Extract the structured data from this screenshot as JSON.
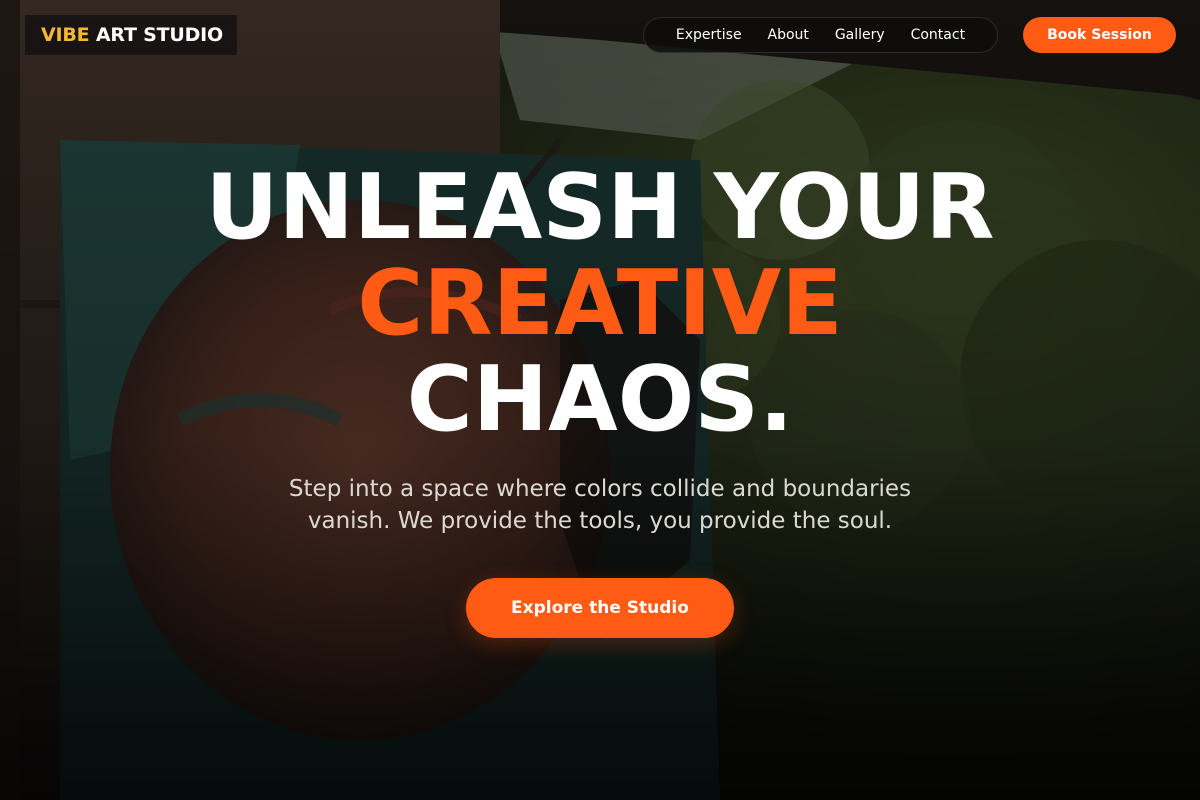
{
  "brand": {
    "accent_word": "VIBE",
    "rest": "ART STUDIO",
    "accent_color": "#f5b82e"
  },
  "nav": {
    "items": [
      {
        "label": "Expertise"
      },
      {
        "label": "About"
      },
      {
        "label": "Gallery"
      },
      {
        "label": "Contact"
      }
    ],
    "cta_label": "Book Session"
  },
  "hero": {
    "headline_line1": "UNLEASH YOUR",
    "headline_line2": "CREATIVE",
    "headline_line3": "CHAOS.",
    "subtitle": "Step into a space where colors collide and boundaries vanish. We provide the tools, you provide the soul.",
    "cta_label": "Explore the Studio"
  },
  "colors": {
    "primary": "#ff5b14",
    "text": "#ffffff"
  }
}
